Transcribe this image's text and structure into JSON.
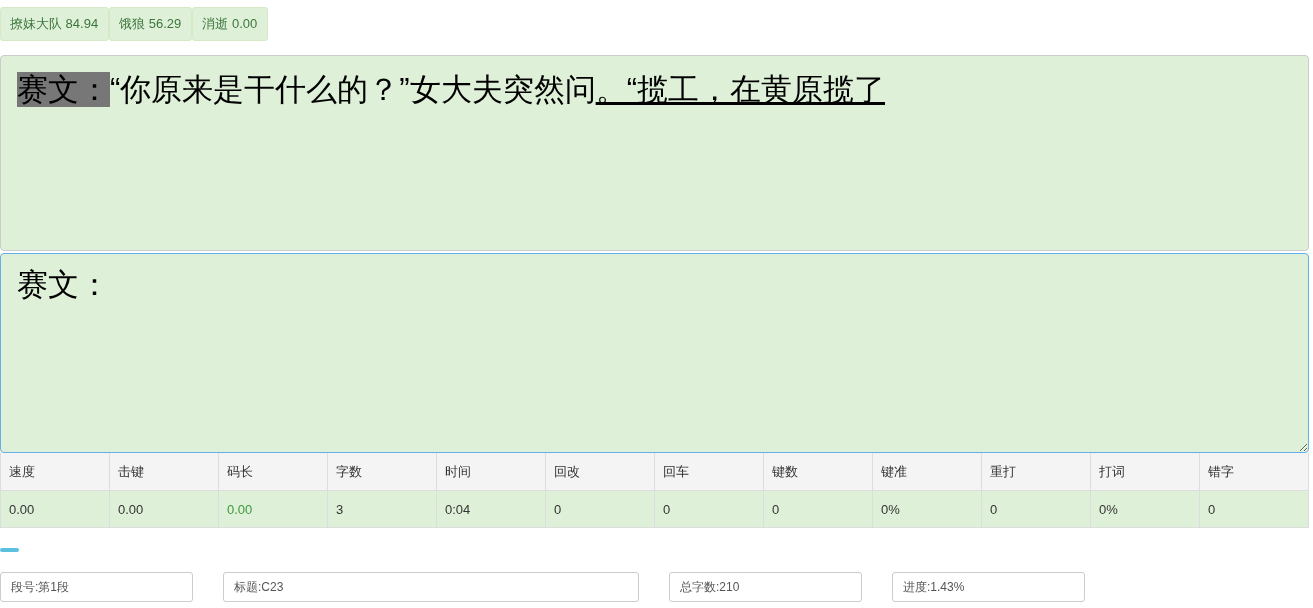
{
  "scores": [
    {
      "name": "撩妹大队",
      "value": "84.94"
    },
    {
      "name": "饿狼",
      "value": "56.29"
    },
    {
      "name": "消逝",
      "value": "0.00"
    }
  ],
  "passage": {
    "segments": [
      {
        "kind": "typed",
        "text": "赛文："
      },
      {
        "kind": "plain",
        "text": "“你原来是干什么的？”女大夫突然问"
      },
      {
        "kind": "underlined",
        "text": "。“揽工，在黄原揽了"
      }
    ]
  },
  "input": {
    "value": "赛文："
  },
  "stats": [
    {
      "label": "速度",
      "value": "0.00",
      "highlighted": false
    },
    {
      "label": "击键",
      "value": "0.00",
      "highlighted": false
    },
    {
      "label": "码长",
      "value": "0.00",
      "highlighted": true
    },
    {
      "label": "字数",
      "value": "3",
      "highlighted": false
    },
    {
      "label": "时间",
      "value": "0:04",
      "highlighted": false
    },
    {
      "label": "回改",
      "value": "0",
      "highlighted": false
    },
    {
      "label": "回车",
      "value": "0",
      "highlighted": false
    },
    {
      "label": "键数",
      "value": "0",
      "highlighted": false
    },
    {
      "label": "键准",
      "value": "0%",
      "highlighted": false
    },
    {
      "label": "重打",
      "value": "0",
      "highlighted": false
    },
    {
      "label": "打词",
      "value": "0%",
      "highlighted": false
    },
    {
      "label": "错字",
      "value": "0",
      "highlighted": false
    }
  ],
  "progress": {
    "level": 0.0143
  },
  "info_fields": [
    {
      "kind": "short",
      "value": "段号:第1段"
    },
    {
      "kind": "long",
      "value": "标题:C23"
    },
    {
      "kind": "short",
      "value": "总字数:210"
    },
    {
      "kind": "short",
      "value": "进度:1.43%"
    }
  ]
}
